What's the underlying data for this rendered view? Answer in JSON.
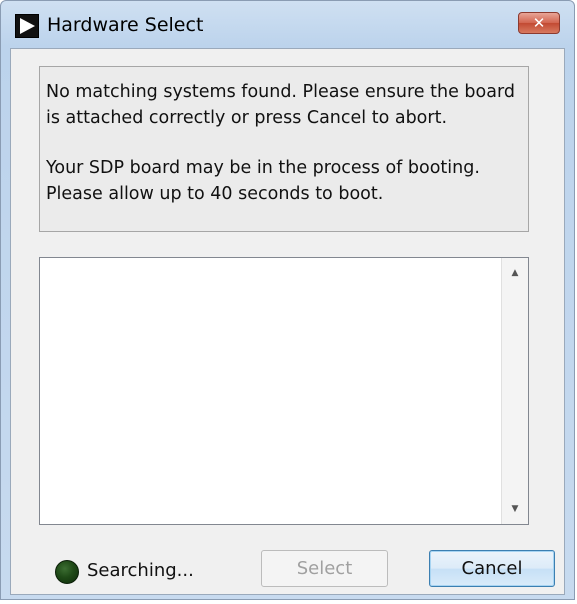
{
  "window": {
    "title": "Hardware Select",
    "close_label": "✕"
  },
  "message": {
    "line1": "No matching systems found. Please ensure the board is attached correctly or press Cancel to abort.",
    "line2": "Your SDP board may be in the process of booting. Please allow up to 40 seconds to boot."
  },
  "list": {
    "items": []
  },
  "status": {
    "text": "Searching...",
    "led_color": "#1f4a17"
  },
  "buttons": {
    "select_label": "Select",
    "cancel_label": "Cancel"
  },
  "icons": {
    "app": "play-arrow-icon",
    "scroll_up": "up-arrow-icon",
    "scroll_down": "down-arrow-icon"
  }
}
